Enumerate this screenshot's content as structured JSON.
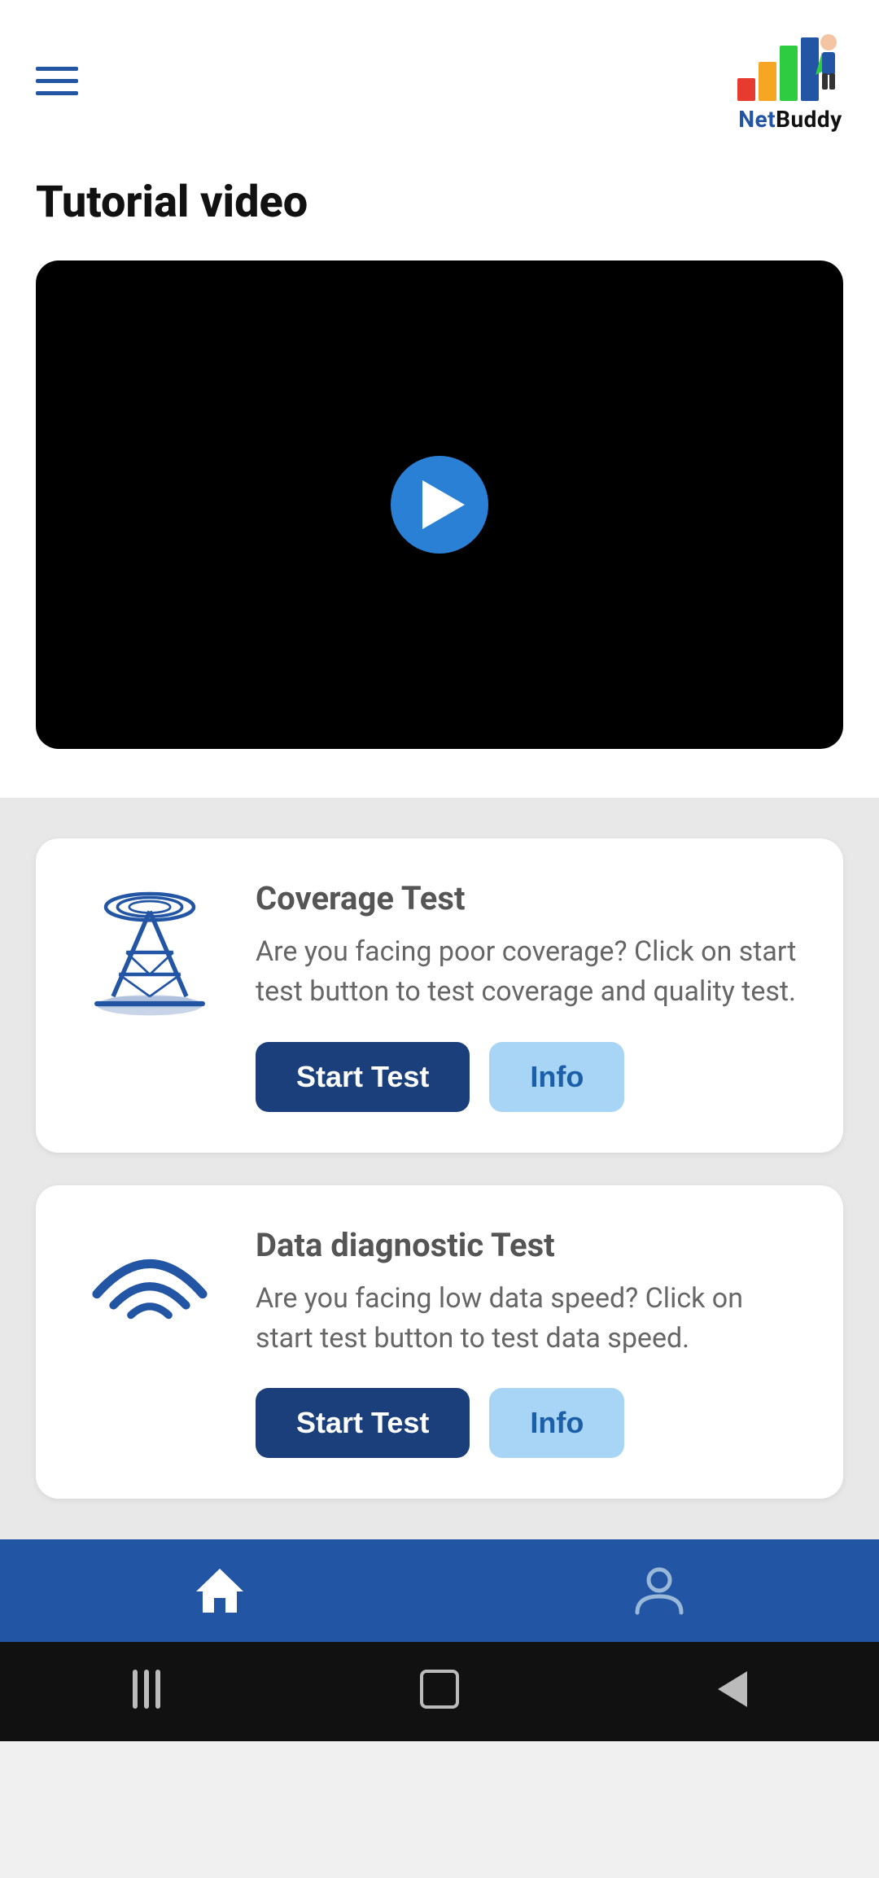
{
  "header": {
    "logo_text_net": "Net",
    "logo_text_buddy": "Buddy"
  },
  "page": {
    "title": "Tutorial video"
  },
  "video": {
    "aria_label": "Tutorial video player"
  },
  "coverage_card": {
    "title": "Coverage Test",
    "description": "Are you facing poor coverage? Click on start test button to test coverage and quality test.",
    "start_label": "Start Test",
    "info_label": "Info"
  },
  "data_diagnostic_card": {
    "title": "Data diagnostic Test",
    "description": "Are you facing low data speed? Click on start test button to test data speed.",
    "start_label": "Start Test",
    "info_label": "Info"
  },
  "bottom_nav": {
    "home_label": "Home",
    "profile_label": "Profile"
  }
}
